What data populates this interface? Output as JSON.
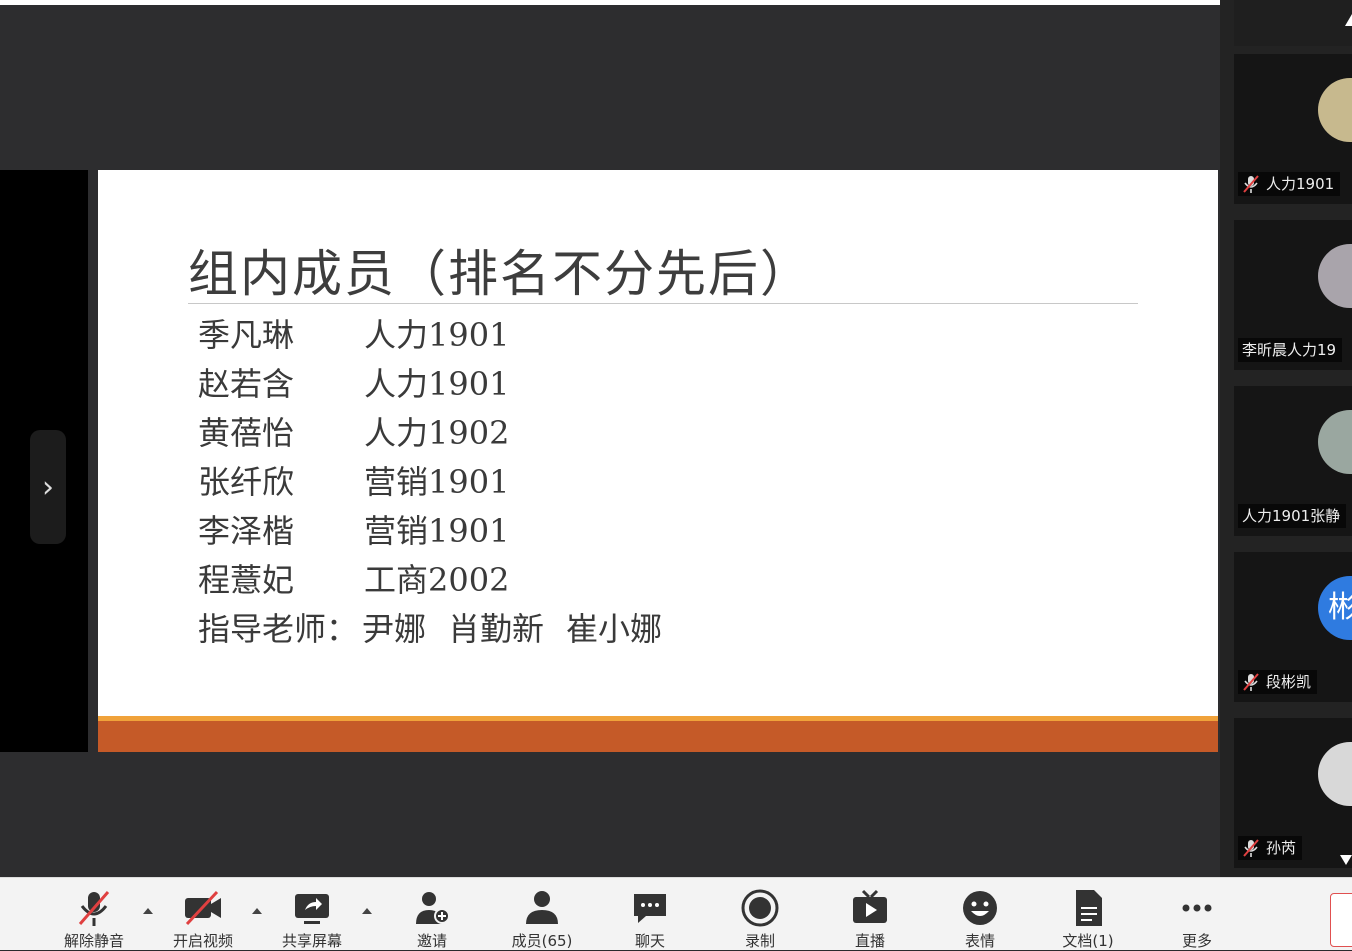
{
  "slide": {
    "title": "组内成员（排名不分先后）",
    "members": [
      {
        "name": "季凡琳",
        "class": "人力1901"
      },
      {
        "name": "赵若含",
        "class": "人力1901"
      },
      {
        "name": "黄蓓怡",
        "class": "人力1902"
      },
      {
        "name": "张纤欣",
        "class": "营销1901"
      },
      {
        "name": "李泽楷",
        "class": "营销1901"
      },
      {
        "name": "程薏妃",
        "class": "工商2002"
      }
    ],
    "advisors_label": "指导老师：",
    "advisors": [
      "尹娜",
      "肖勤新",
      "崔小娜"
    ]
  },
  "left_panel": {
    "expand_glyph": "›"
  },
  "participants": [
    {
      "name": "人力1901",
      "muted": true,
      "avatar_color": "#c7b98e"
    },
    {
      "name": "李昕晨人力19",
      "muted": false,
      "avatar_color": "#a9a4ab"
    },
    {
      "name": "人力1901张静",
      "muted": false,
      "avatar_color": "#9aa7a0"
    },
    {
      "name": "段彬凯",
      "muted": true,
      "avatar_color": "#2f7be0",
      "avatar_text": "彬"
    },
    {
      "name": "孙芮",
      "muted": true,
      "avatar_color": "#d8d8d8"
    }
  ],
  "toolbar": {
    "unmute": "解除静音",
    "start_video": "开启视频",
    "share_screen": "共享屏幕",
    "invite": "邀请",
    "members": "成员(65)",
    "chat": "聊天",
    "record": "录制",
    "live": "直播",
    "reactions": "表情",
    "docs": "文档(1)",
    "more": "更多"
  },
  "icons": {
    "unmute": "mic-off-icon",
    "start_video": "video-off-icon",
    "share_screen": "share-screen-icon",
    "invite": "invite-user-icon",
    "members": "members-icon",
    "chat": "chat-icon",
    "record": "record-icon",
    "live": "live-icon",
    "reactions": "emoji-icon",
    "docs": "document-icon",
    "more": "more-icon"
  },
  "colors": {
    "slide_footer": "#c55a28",
    "slide_footer_line": "#f0a23a",
    "stage_bg": "#2d2d2f",
    "toolbar_bg": "#f3f3f3"
  }
}
